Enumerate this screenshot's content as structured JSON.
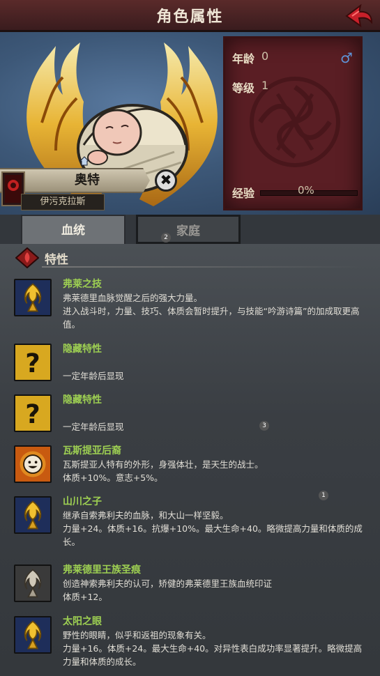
{
  "header": {
    "title": "角色属性"
  },
  "character": {
    "name": "奥特",
    "house": "伊污克拉斯",
    "close_glyph": "✖"
  },
  "stats": {
    "age_label": "年龄",
    "age_value": "0",
    "level_label": "等级",
    "level_value": "1",
    "xp_label": "经验",
    "xp_value": "0%",
    "xp_fraction": 0,
    "gender_icon": "male-icon",
    "gender_glyph": "♂"
  },
  "tabs": [
    {
      "label": "血统",
      "active": true
    },
    {
      "label": "家庭",
      "active": false
    }
  ],
  "badges": [
    "2",
    "3",
    "1"
  ],
  "section": {
    "label": "特性"
  },
  "traits": [
    {
      "name": "弗莱之技",
      "icon": "golden-flame-icon",
      "desc": "弗莱德里血脉觉醒之后的强大力量。\n进入战斗时，力量、技巧、体质会暂时提升，与技能“吟游诗篇”的加成取更高值。"
    },
    {
      "name": "隐藏特性",
      "icon": "question-mark-icon",
      "desc": "\n一定年龄后显现"
    },
    {
      "name": "隐藏特性",
      "icon": "question-mark-icon",
      "desc": "\n一定年龄后显现"
    },
    {
      "name": "瓦斯提亚后裔",
      "icon": "smiley-sun-icon",
      "desc": "瓦斯提亚人特有的外形，身强体壮，是天生的战士。\n体质+10%。意志+5%。"
    },
    {
      "name": "山川之子",
      "icon": "golden-flame-icon",
      "desc": "继承自索弗利夫的血脉，和大山一样坚毅。\n力量+24。体质+16。抗爆+10%。最大生命+40。略微提高力量和体质的成长。"
    },
    {
      "name": "弗莱德里王族圣痕",
      "icon": "silver-flame-icon",
      "desc": "创造神索弗利夫的认可，矫健的弗莱德里王族血统印证\n体质+12。"
    },
    {
      "name": "太阳之眼",
      "icon": "golden-flame-icon",
      "desc": "野性的眼睛，似乎和返祖的现象有关。\n力量+16。体质+24。最大生命+40。对异性表白成功率显著提升。略微提高力量和体质的成长。"
    }
  ],
  "colors": {
    "accent_green": "#9dcf52",
    "header_red": "#5a2a2a",
    "tapestry": "#5a1e24"
  }
}
